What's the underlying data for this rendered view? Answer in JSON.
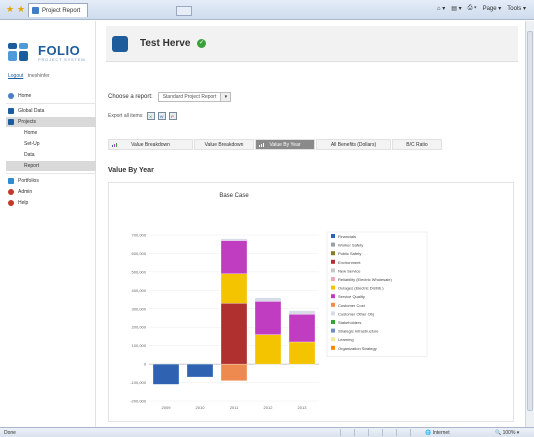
{
  "browser": {
    "tab_title": "Project Report",
    "tools": [
      "Page",
      "Tools"
    ],
    "status_done": "Done",
    "status_zone": "Internet",
    "status_zoom": "100%"
  },
  "sidebar": {
    "logo_text": "FOLIO",
    "logo_sub": "PROJECT SYSTEM",
    "logout": "Logout",
    "username": "tneshinfer",
    "items": [
      {
        "label": "Home",
        "color": "#4a7fc1"
      },
      {
        "label": "Global Data",
        "color": "#1f5c9c"
      },
      {
        "label": "Projects",
        "color": "#1f5c9c"
      },
      {
        "label": "Portfolios",
        "color": "#2e8bd6"
      },
      {
        "label": "Admin",
        "color": "#c0392b"
      },
      {
        "label": "Help",
        "color": "#c0392b"
      }
    ],
    "subitems": [
      "Home",
      "Set-Up",
      "Data",
      "Report"
    ]
  },
  "header": {
    "project_name": "Test Herve"
  },
  "report": {
    "choose_label": "Choose a report:",
    "selected": "Standard Project Report",
    "export_label": "Export all items:"
  },
  "tabs": [
    {
      "label": "Value Breakdown",
      "active": false
    },
    {
      "label": "Value Breakdown",
      "active": false
    },
    {
      "label": "Value By Year",
      "active": true
    },
    {
      "label": "All Benefits (Dollars)",
      "active": false
    },
    {
      "label": "B/C Ratio",
      "active": false
    }
  ],
  "section_title": "Value By Year",
  "chart_data": {
    "type": "bar",
    "stacked": true,
    "title": "Base Case",
    "categories": [
      "2009",
      "2010",
      "2011",
      "2012",
      "2013"
    ],
    "ylim": [
      -200000,
      700000
    ],
    "yticks": [
      "700,000",
      "600,000",
      "500,000",
      "400,000",
      "300,000",
      "200,000",
      "100,000",
      "0",
      "-100,000",
      "-200,000"
    ],
    "legend_position": "right",
    "series": [
      {
        "name": "Financials",
        "color": "#2f62b0",
        "values": [
          -110000,
          -70000,
          0,
          0,
          0
        ]
      },
      {
        "name": "Worker Safety",
        "color": "#9aa0a6",
        "values": [
          0,
          0,
          0,
          0,
          0
        ]
      },
      {
        "name": "Public Safety",
        "color": "#8a7a2a",
        "values": [
          0,
          0,
          0,
          0,
          0
        ]
      },
      {
        "name": "Environment",
        "color": "#b03030",
        "values": [
          0,
          0,
          330000,
          0,
          0
        ]
      },
      {
        "name": "New Service",
        "color": "#c8c8c8",
        "values": [
          0,
          0,
          0,
          0,
          0
        ]
      },
      {
        "name": "Reliability (Electric Wholesale)",
        "color": "#e8a9b9",
        "values": [
          0,
          0,
          0,
          0,
          0
        ]
      },
      {
        "name": "Outages (Electric Distrib.)",
        "color": "#f5c400",
        "values": [
          0,
          0,
          160000,
          160000,
          120000
        ]
      },
      {
        "name": "Service Quality",
        "color": "#c03cc0",
        "values": [
          0,
          0,
          180000,
          180000,
          150000
        ]
      },
      {
        "name": "Customer Cost",
        "color": "#ee8a50",
        "values": [
          0,
          0,
          -90000,
          0,
          0
        ]
      },
      {
        "name": "Customer Other Obj",
        "color": "#d7dbe8",
        "values": [
          0,
          0,
          10000,
          20000,
          20000
        ]
      },
      {
        "name": "Stakeholders",
        "color": "#3aa13a",
        "values": [
          0,
          0,
          0,
          0,
          0
        ]
      },
      {
        "name": "Strategic Infrastructure",
        "color": "#6d8fbf",
        "values": [
          0,
          0,
          0,
          0,
          0
        ]
      },
      {
        "name": "Learning",
        "color": "#f4e7a0",
        "values": [
          0,
          0,
          0,
          0,
          0
        ]
      },
      {
        "name": "Organization Strategy",
        "color": "#f08a00",
        "values": [
          0,
          0,
          0,
          0,
          0
        ]
      }
    ]
  }
}
